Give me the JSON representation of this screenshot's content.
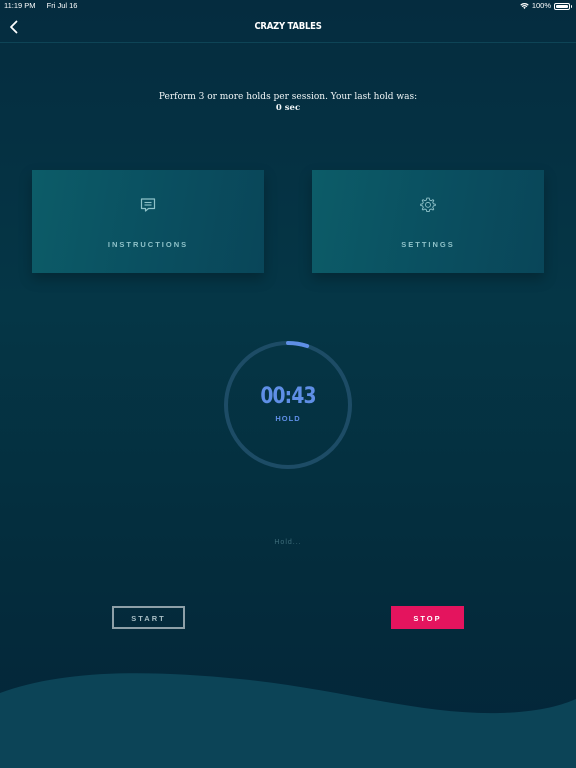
{
  "status_bar": {
    "time": "11:19 PM",
    "date": "Fri Jul 16",
    "battery": "100%",
    "battery_level": 1.0
  },
  "nav": {
    "title": "CRAZY TABLES",
    "back_icon": "chevron-left-icon"
  },
  "session": {
    "text": "Perform 3 or more holds per session. Your last hold was:",
    "last_hold": "0 sec"
  },
  "cards": {
    "instructions": {
      "label": "INSTRUCTIONS",
      "icon": "message-icon"
    },
    "settings": {
      "label": "SETTINGS",
      "icon": "gear-icon"
    }
  },
  "timer": {
    "time": "00:43",
    "phase": "HOLD",
    "progress": 0.05
  },
  "status_text": "Hold...",
  "buttons": {
    "start": "START",
    "stop": "STOP"
  },
  "colors": {
    "accent": "#5f8fe6",
    "stop": "#e4145e",
    "card": "#0a5262",
    "background": "#042f40"
  }
}
